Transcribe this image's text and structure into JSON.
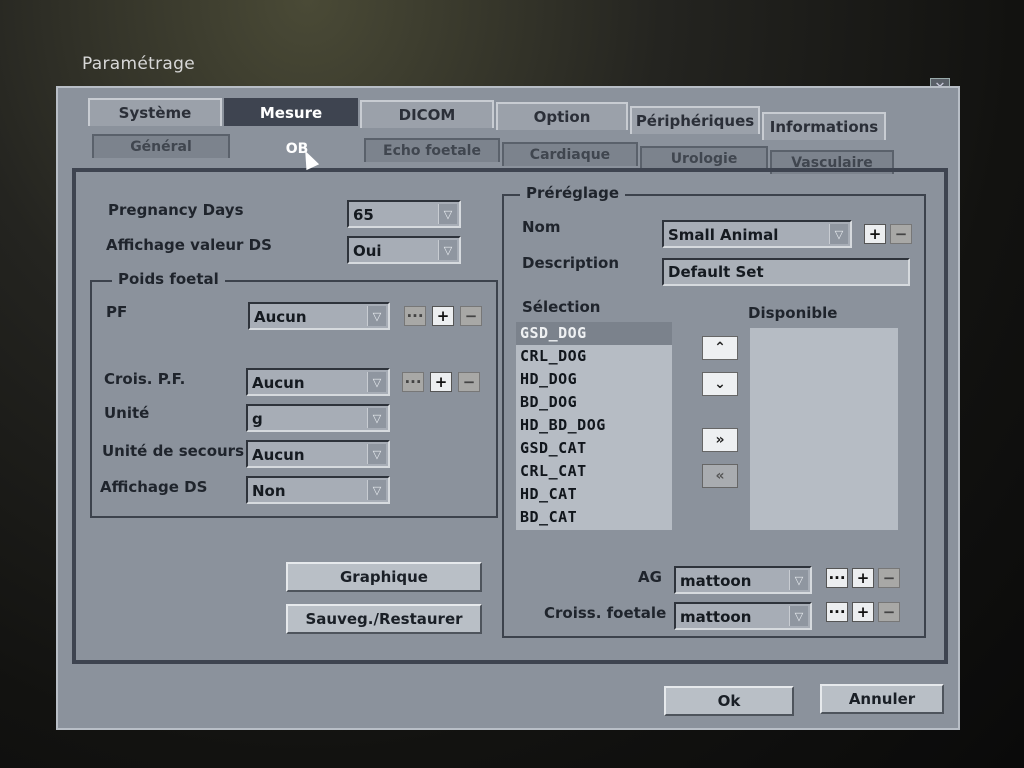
{
  "window": {
    "title": "Paramétrage",
    "close_label": "✕"
  },
  "tabs": [
    "Système",
    "Mesure",
    "DICOM",
    "Option",
    "Périphériques",
    "Informations"
  ],
  "subtabs": [
    "Général",
    "OB",
    "Echo foetale",
    "Cardiaque",
    "Urologie",
    "Vasculaire"
  ],
  "left": {
    "pregnancy_days_label": "Pregnancy Days",
    "pregnancy_days_value": "65",
    "affichage_valeur_label": "Affichage valeur DS",
    "affichage_valeur_value": "Oui",
    "poids_foetal": {
      "legend": "Poids foetal",
      "pf_label": "PF",
      "pf_value": "Aucun",
      "crois_label": "Crois. P.F.",
      "crois_value": "Aucun",
      "unite_label": "Unité",
      "unite_value": "g",
      "unite_secours_label": "Unité de secours",
      "unite_secours_value": "Aucun",
      "affichage_ds_label": "Affichage DS",
      "affichage_ds_value": "Non"
    },
    "graphique_label": "Graphique",
    "sauveg_label": "Sauveg./Restaurer"
  },
  "right": {
    "legend": "Préréglage",
    "nom_label": "Nom",
    "nom_value": "Small Animal",
    "description_label": "Description",
    "description_value": "Default Set",
    "selection_label": "Sélection",
    "disponible_label": "Disponible",
    "selection_items": [
      "GSD_DOG",
      "CRL_DOG",
      "HD_DOG",
      "BD_DOG",
      "HD_BD_DOG",
      "GSD_CAT",
      "CRL_CAT",
      "HD_CAT",
      "BD_CAT"
    ],
    "up_label": "⌃",
    "down_label": "⌄",
    "move_right_label": "»",
    "move_left_label": "«",
    "ag_label": "AG",
    "ag_value": "mattoon",
    "croiss_label": "Croiss. foetale",
    "croiss_value": "mattoon"
  },
  "buttons": {
    "ok": "Ok",
    "annuler": "Annuler"
  },
  "mini": {
    "dots": "···",
    "plus": "+",
    "minus": "−"
  },
  "arrow_glyph": "▽"
}
